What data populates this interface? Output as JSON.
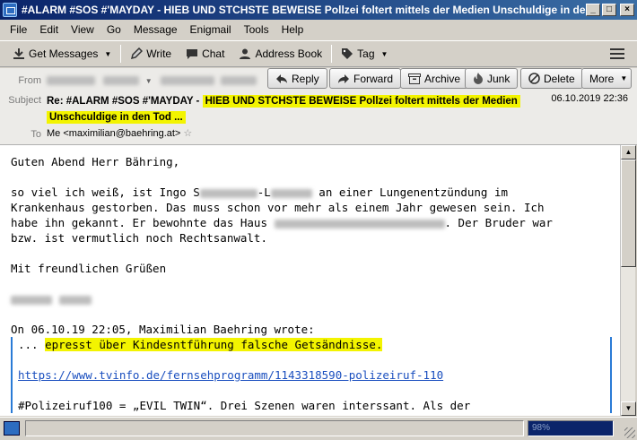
{
  "window": {
    "title": "#ALARM #SOS #'MAYDAY - HIEB UND STCHSTE BEWEISE Pollzei foltert mittels der Medien Unschuldige in den ..."
  },
  "menu": [
    "File",
    "Edit",
    "View",
    "Go",
    "Message",
    "Enigmail",
    "Tools",
    "Help"
  ],
  "toolbar": {
    "get_messages": "Get Messages",
    "write": "Write",
    "chat": "Chat",
    "address_book": "Address Book",
    "tag": "Tag"
  },
  "header": {
    "from_label": "From",
    "subject_label": "Subject",
    "to_label": "To",
    "subject_prefix": "Re: #ALARM #SOS #'MAYDAY -",
    "subject_highlight_1": "HIEB UND STCHSTE BEWEISE Pollzei foltert mittels der Medien",
    "subject_highlight_2": "Unschculdige in den Tod ...",
    "date": "06.10.2019 22:36",
    "to": "Me <maximilian@baehring.at>",
    "actions": {
      "reply": "Reply",
      "forward": "Forward",
      "archive": "Archive",
      "junk": "Junk",
      "delete": "Delete",
      "more": "More"
    }
  },
  "body": {
    "greeting": "Guten Abend Herr Bähring,",
    "p1_a": "so viel ich weiß, ist Ingo S",
    "p1_b": "-L",
    "p1_c": " an einer Lungenentzündung im",
    "p2": "Krankenhaus gestorben. Das muss schon vor mehr als einem Jahr gewesen sein. Ich",
    "p3_a": "habe ihn gekannt. Er bewohnte das Haus ",
    "p3_b": ". Der Bruder war",
    "p4": "bzw. ist vermutlich noch Rechtsanwalt.",
    "closing": "Mit freundlichen Grüßen",
    "quote_header": "On 06.10.19 22:05, Maximilian Baehring wrote:",
    "quote_line1_prefix": "... ",
    "quote_line1_hl": "epresst über Kindesntführung falsche Getsändnisse.",
    "quote_link": "https://www.tvinfo.de/fernsehprogramm/1143318590-polizeiruf-110",
    "quote_line3": "#Polizeiruf100 = „EVIL TWIN“. Drei Szenen waren interssant. Als der"
  },
  "statusbar": {
    "progress_text": "98%"
  }
}
